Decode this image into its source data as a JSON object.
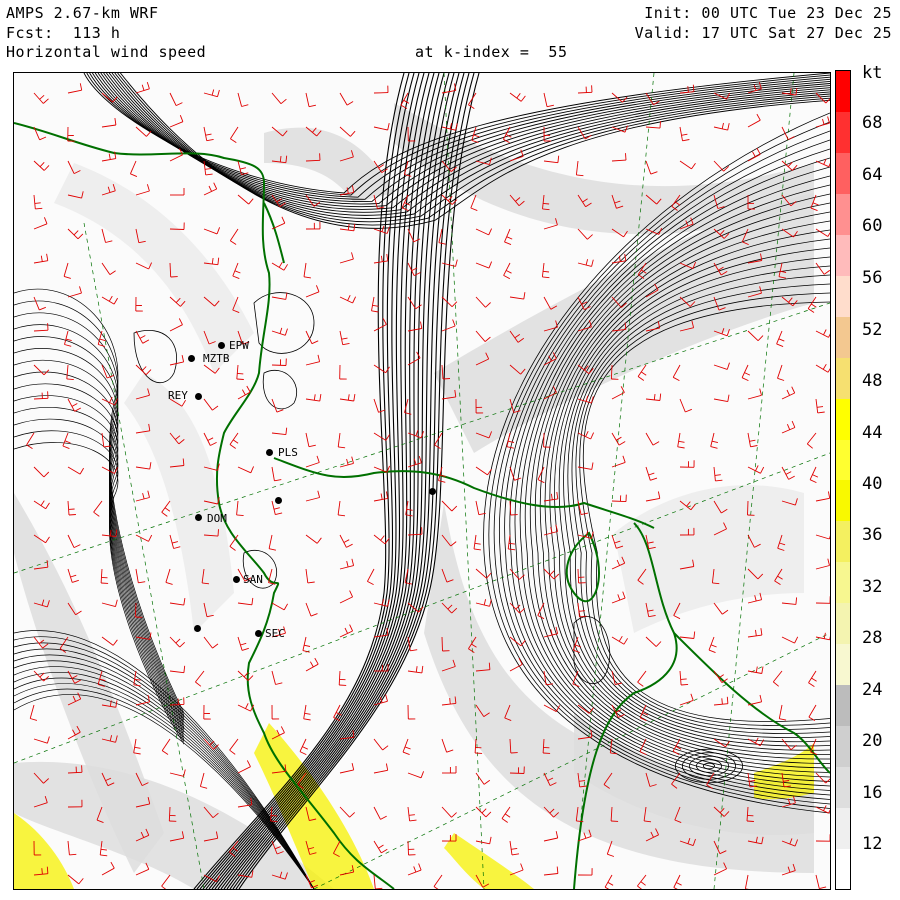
{
  "header": {
    "model": "AMPS 2.67-km WRF",
    "forecast": "Fcst:  113 h",
    "field": "Horizontal wind speed",
    "level": "at k-index =  55",
    "init": "Init: 00 UTC Tue 23 Dec 25",
    "valid": "Valid: 17 UTC Sat 27 Dec 25"
  },
  "colorbar": {
    "unit": "kt",
    "ticks": [
      "68",
      "64",
      "60",
      "56",
      "52",
      "48",
      "44",
      "40",
      "36",
      "32",
      "28",
      "24",
      "20",
      "16",
      "12"
    ],
    "colors": [
      "#ffffff",
      "#efefef",
      "#dedede",
      "#cfcfcf",
      "#bcbcbc",
      "#f8f8d0",
      "#f4f4b0",
      "#f7f790",
      "#f4f060",
      "#f9f900",
      "#ffff30",
      "#ffff00",
      "#f6e070",
      "#f3c890",
      "#ffddcc",
      "#ffbbbb",
      "#ff9090",
      "#ff6060",
      "#ff3030",
      "#ff0000"
    ]
  },
  "map": {
    "coastline_color": "#007000",
    "barb_color": "#e00000",
    "stations": [
      {
        "id": "EPW"
      },
      {
        "id": "MZTB"
      },
      {
        "id": "REY"
      },
      {
        "id": "PLS"
      },
      {
        "id": "DOM"
      },
      {
        "id": "SAN"
      },
      {
        "id": "SEC"
      }
    ]
  }
}
